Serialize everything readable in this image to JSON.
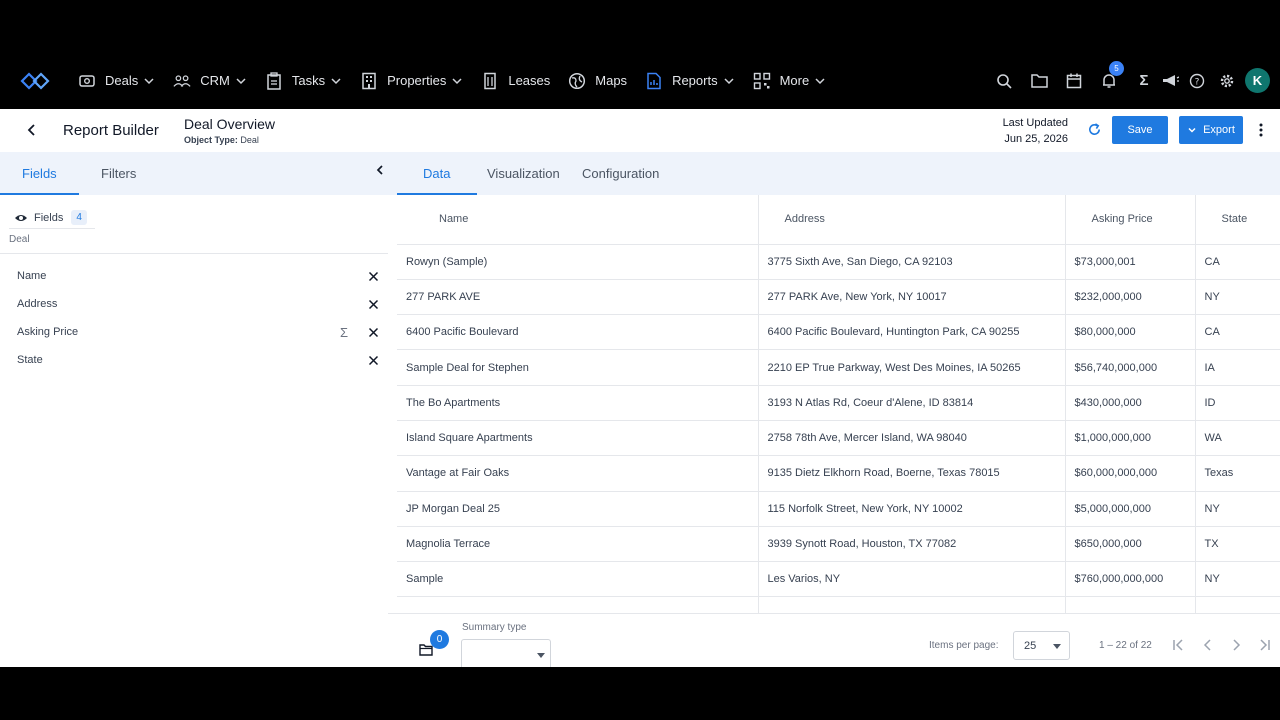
{
  "nav": {
    "items": [
      {
        "label": "Deals",
        "icon": "deals-icon",
        "chevron": true
      },
      {
        "label": "CRM",
        "icon": "people-icon",
        "chevron": true
      },
      {
        "label": "Tasks",
        "icon": "clipboard-icon",
        "chevron": true
      },
      {
        "label": "Properties",
        "icon": "building-icon",
        "chevron": true
      },
      {
        "label": "Leases",
        "icon": "office-icon",
        "chevron": false
      },
      {
        "label": "Maps",
        "icon": "globe-icon",
        "chevron": false
      },
      {
        "label": "Reports",
        "icon": "report-icon",
        "chevron": true,
        "active": true
      },
      {
        "label": "More",
        "icon": "grid-icon",
        "chevron": true
      }
    ],
    "notifications": "5",
    "avatar_initial": "K"
  },
  "header": {
    "title": "Report Builder",
    "report_name": "Deal Overview",
    "object_type_label": "Object Type:",
    "object_type": "Deal",
    "last_updated_label": "Last Updated",
    "last_updated": "Jun 25, 2026",
    "save_label": "Save",
    "export_label": "Export"
  },
  "left": {
    "tabs": [
      "Fields",
      "Filters"
    ],
    "fields_chip_label": "Fields",
    "fields_count": "4",
    "group_label": "Deal",
    "fields": [
      {
        "name": "Name",
        "sigma": false
      },
      {
        "name": "Address",
        "sigma": false
      },
      {
        "name": "Asking Price",
        "sigma": true
      },
      {
        "name": "State",
        "sigma": false
      }
    ]
  },
  "content": {
    "tabs": [
      "Data",
      "Visualization",
      "Configuration"
    ]
  },
  "table": {
    "headers": [
      "Name",
      "Address",
      "Asking Price",
      "State"
    ],
    "rows": [
      [
        "Rowyn (Sample)",
        "3775 Sixth Ave, San Diego, CA 92103",
        "$73,000,001",
        "CA"
      ],
      [
        "277 PARK AVE",
        "277 PARK Ave, New York, NY 10017",
        "$232,000,000",
        "NY"
      ],
      [
        "6400 Pacific Boulevard",
        "6400 Pacific Boulevard, Huntington Park, CA 90255",
        "$80,000,000",
        "CA"
      ],
      [
        "Sample Deal for Stephen",
        "2210 EP True Parkway, West Des Moines, IA 50265",
        "$56,740,000,000",
        "IA"
      ],
      [
        "The Bo Apartments",
        "3193 N Atlas Rd, Coeur d'Alene, ID 83814",
        "$430,000,000",
        "ID"
      ],
      [
        "Island Square Apartments",
        "2758 78th Ave, Mercer Island, WA 98040",
        "$1,000,000,000",
        "WA"
      ],
      [
        "Vantage at Fair Oaks",
        "9135 Dietz Elkhorn Road, Boerne, Texas 78015",
        "$60,000,000,000",
        "Texas"
      ],
      [
        "JP Morgan Deal 25",
        "115 Norfolk Street, New York, NY 10002",
        "$5,000,000,000",
        "NY"
      ],
      [
        "Magnolia Terrace",
        "3939 Synott Road, Houston, TX 77082",
        "$650,000,000",
        "TX"
      ],
      [
        "Sample",
        "Les Varios, NY",
        "$760,000,000,000",
        "NY"
      ]
    ]
  },
  "footer": {
    "selected_count": "0",
    "summary_label": "Summary type",
    "items_per_page_label": "Items per page:",
    "items_per_page": "25",
    "range": "1 – 22 of 22"
  }
}
